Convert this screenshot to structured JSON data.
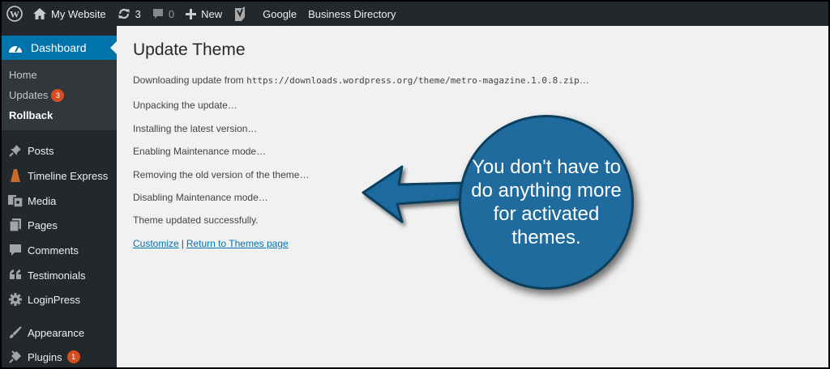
{
  "adminbar": {
    "site_name": "My Website",
    "updates_count": "3",
    "comments_count": "0",
    "new_label": "New",
    "google_label": "Google",
    "directory_label": "Business Directory"
  },
  "sidebar": {
    "dashboard_label": "Dashboard",
    "submenu": {
      "home": "Home",
      "updates": "Updates",
      "updates_badge": "3",
      "rollback": "Rollback"
    },
    "items": [
      {
        "label": "Posts",
        "icon": "pin-icon"
      },
      {
        "label": "Timeline Express",
        "icon": "timeline-icon"
      },
      {
        "label": "Media",
        "icon": "media-icon"
      },
      {
        "label": "Pages",
        "icon": "pages-icon"
      },
      {
        "label": "Comments",
        "icon": "comments-icon"
      },
      {
        "label": "Testimonials",
        "icon": "quote-icon"
      },
      {
        "label": "LoginPress",
        "icon": "gear-icon"
      },
      {
        "label": "Appearance",
        "icon": "brush-icon"
      },
      {
        "label": "Plugins",
        "icon": "plugin-icon",
        "badge": "1"
      }
    ]
  },
  "main": {
    "title": "Update Theme",
    "downloading_prefix": "Downloading update from ",
    "download_url": "https://downloads.wordpress.org/theme/metro-magazine.1.0.8.zip",
    "downloading_suffix": "…",
    "steps": [
      "Unpacking the update…",
      "Installing the latest version…",
      "Enabling Maintenance mode…",
      "Removing the old version of the theme…",
      "Disabling Maintenance mode…",
      "Theme updated successfully."
    ],
    "customize_link": "Customize",
    "separator": "|",
    "return_link": "Return to Themes page"
  },
  "callout": {
    "text": "You don't have to do anything more for activated themes."
  },
  "colors": {
    "adminbar_bg": "#23282d",
    "accent": "#0073aa",
    "badge": "#d54e21",
    "callout_fill": "#1f6b9e"
  }
}
